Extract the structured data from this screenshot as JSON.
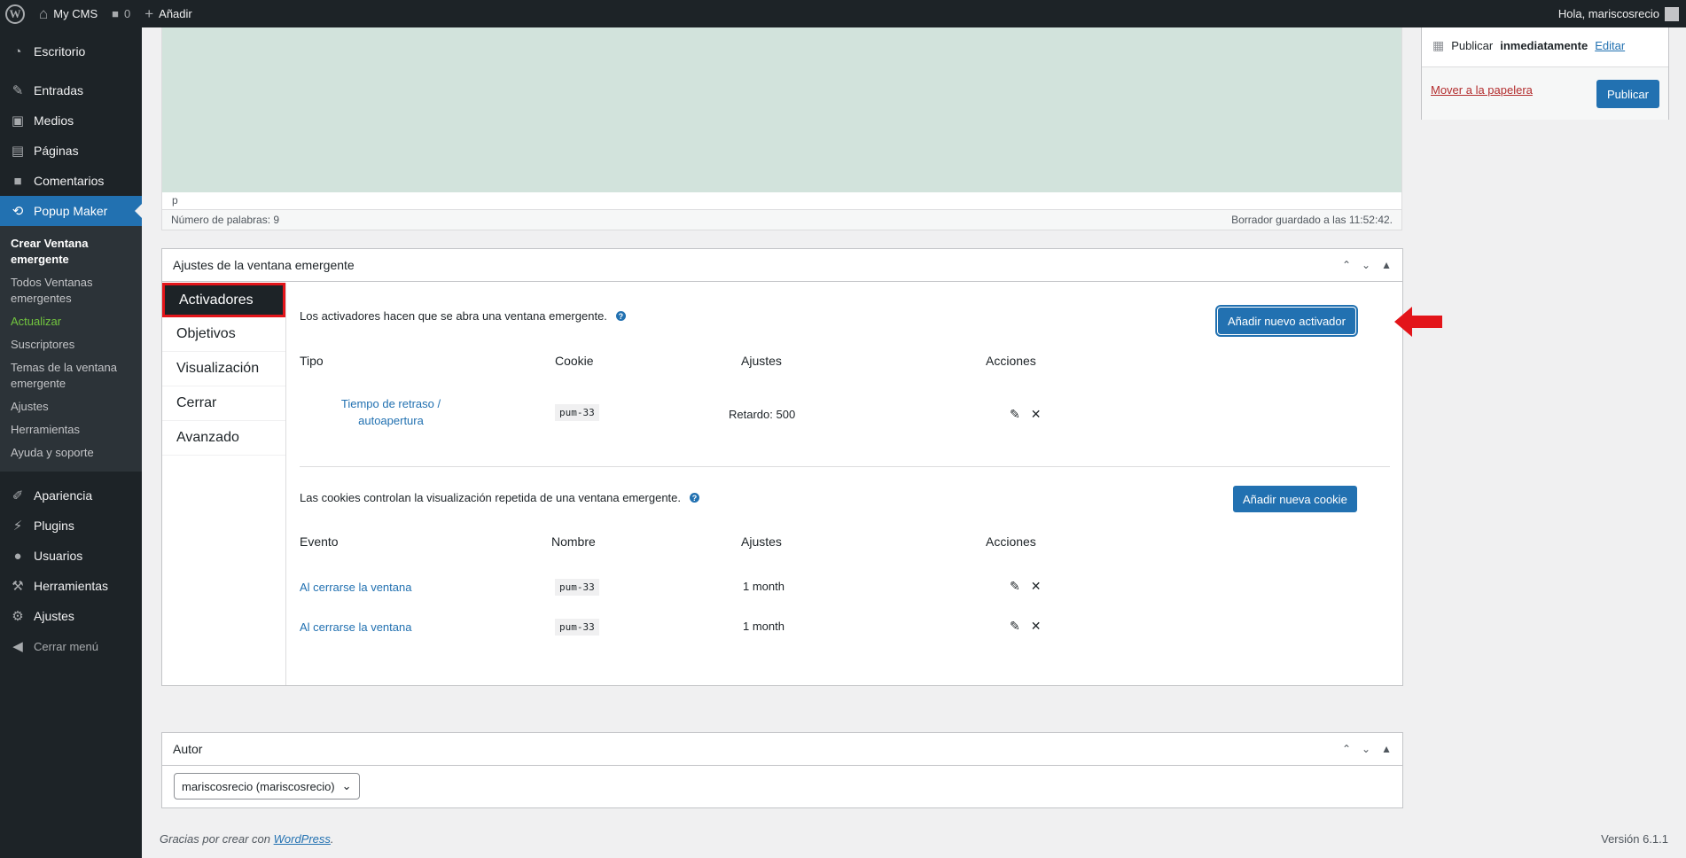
{
  "adminbar": {
    "site_name": "My CMS",
    "comments_count": "0",
    "new_label": "Añadir",
    "greeting": "Hola, mariscosrecio"
  },
  "sidebar": {
    "items_top": [
      {
        "label": "Escritorio",
        "icon": "dashboard-icon"
      },
      {
        "label": "Entradas",
        "icon": "pin-icon"
      },
      {
        "label": "Medios",
        "icon": "media-icon"
      },
      {
        "label": "Páginas",
        "icon": "pages-icon"
      },
      {
        "label": "Comentarios",
        "icon": "comment-icon"
      }
    ],
    "current": {
      "label": "Popup Maker",
      "icon": "popup-maker-icon"
    },
    "submenu": [
      "Crear Ventana emergente",
      "Todos Ventanas emergentes",
      "Actualizar",
      "Suscriptores",
      "Temas de la ventana emergente",
      "Ajustes",
      "Herramientas",
      "Ayuda y soporte"
    ],
    "items_bottom": [
      {
        "label": "Apariencia",
        "icon": "brush-icon"
      },
      {
        "label": "Plugins",
        "icon": "plugin-icon"
      },
      {
        "label": "Usuarios",
        "icon": "user-icon"
      },
      {
        "label": "Herramientas",
        "icon": "wrench-icon"
      },
      {
        "label": "Ajustes",
        "icon": "settings-icon"
      }
    ],
    "collapse_label": "Cerrar menú"
  },
  "editor": {
    "path": "p",
    "word_count": "Número de palabras: 9",
    "draft_saved": "Borrador guardado a las 11:52:42."
  },
  "publish": {
    "schedule_prefix": "Publicar",
    "schedule_value": "inmediatamente",
    "edit_label": "Editar",
    "trash_label": "Mover a la papelera",
    "publish_label": "Publicar"
  },
  "popup_settings": {
    "title": "Ajustes de la ventana emergente",
    "tabs": [
      "Activadores",
      "Objetivos",
      "Visualización",
      "Cerrar",
      "Avanzado"
    ],
    "triggers": {
      "intro": "Los activadores hacen que se abra una ventana emergente.",
      "add_button": "Añadir nuevo activador",
      "headers": [
        "Tipo",
        "Cookie",
        "Ajustes",
        "Acciones"
      ],
      "rows": [
        {
          "type_line1": "Tiempo de retraso /",
          "type_line2": "autoapertura",
          "cookie": "pum-33",
          "settings_label": "Retardo:",
          "settings_value": "500"
        }
      ]
    },
    "cookies": {
      "intro": "Las cookies controlan la visualización repetida de una ventana emergente.",
      "add_button": "Añadir nueva cookie",
      "headers": [
        "Evento",
        "Nombre",
        "Ajustes",
        "Acciones"
      ],
      "rows": [
        {
          "event": "Al cerrarse la ventana",
          "name": "pum-33",
          "settings": "1 month"
        },
        {
          "event": "Al cerrarse la ventana",
          "name": "pum-33",
          "settings": "1 month"
        }
      ]
    }
  },
  "author": {
    "title": "Autor",
    "selected": "mariscosrecio (mariscosrecio)"
  },
  "footer": {
    "thanks_prefix": "Gracias por crear con",
    "thanks_link": "WordPress",
    "thanks_suffix": ".",
    "version": "Versión 6.1.1"
  },
  "colors": {
    "accent": "#2271b1",
    "sidebar_bg": "#1d2327",
    "highlight_red": "#e3151a",
    "editor_bg": "#d2e3dc"
  }
}
